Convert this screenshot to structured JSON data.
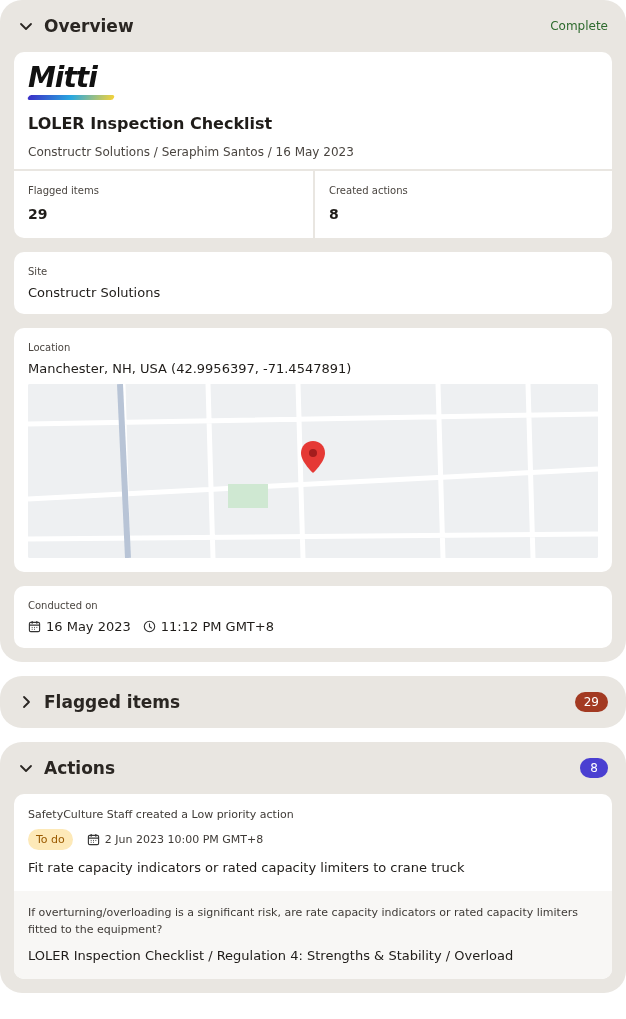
{
  "overview": {
    "title": "Overview",
    "expanded": true,
    "status": "Complete",
    "logo": "Mitti",
    "report_title": "LOLER Inspection Checklist",
    "subtitle": "Constructr Solutions / Seraphim Santos / 16 May 2023",
    "stats": [
      {
        "label": "Flagged items",
        "value": "29"
      },
      {
        "label": "Created actions",
        "value": "8"
      }
    ],
    "site": {
      "label": "Site",
      "value": "Constructr Solutions"
    },
    "location": {
      "label": "Location",
      "value": "Manchester, NH, USA (42.9956397, -71.4547891)"
    },
    "conducted": {
      "label": "Conducted on",
      "date": "16 May 2023",
      "time": "11:12 PM GMT+8"
    }
  },
  "flagged_items": {
    "title": "Flagged items",
    "expanded": false,
    "count": "29",
    "color": "#a33a22"
  },
  "actions": {
    "title": "Actions",
    "expanded": true,
    "count": "8",
    "color": "#4a3fd1",
    "items": [
      {
        "creator": "SafetyCulture Staff created a Low priority action",
        "status": "To do",
        "due": "2 Jun 2023 10:00 PM GMT+8",
        "title": "Fit rate capacity indicators or rated capacity limiters to crane truck",
        "question": "If overturning/overloading is a significant risk, are rate capacity indicators or rated capacity limiters fitted to the equipment?",
        "path": "LOLER Inspection Checklist / Regulation 4: Strengths & Stability / Overload"
      }
    ]
  }
}
